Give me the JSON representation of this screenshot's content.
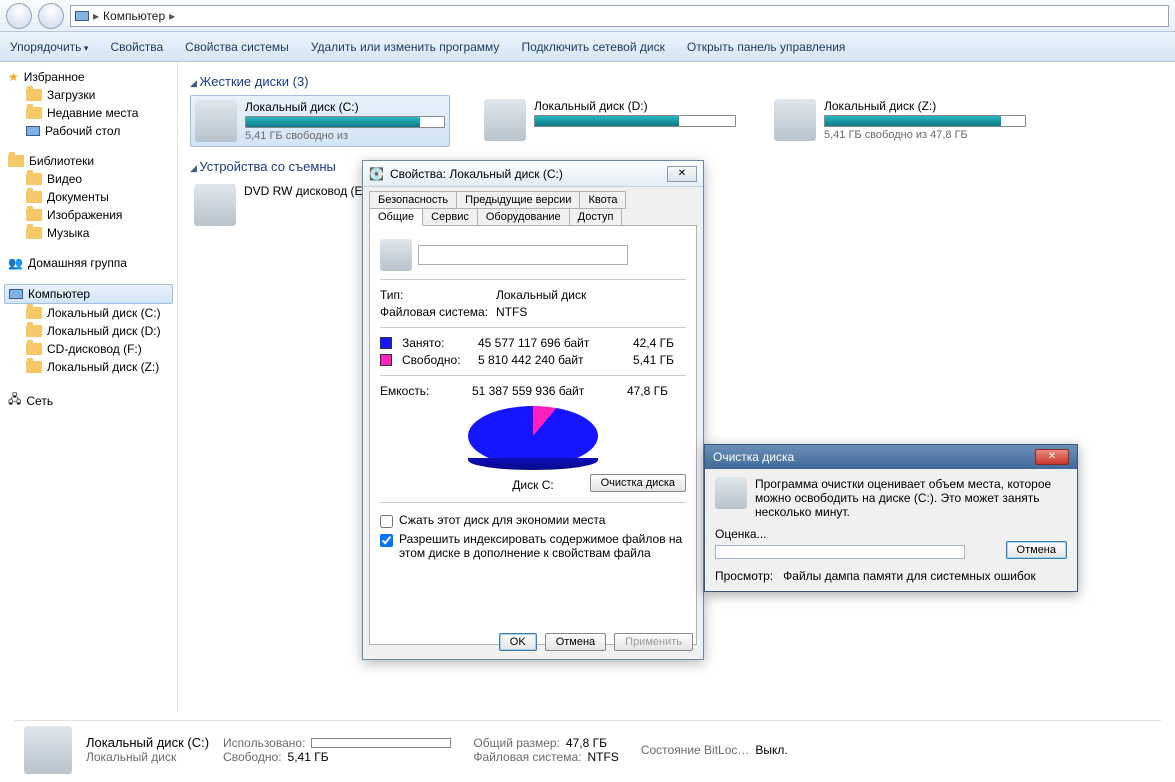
{
  "breadcrumb": {
    "root": "Компьютер"
  },
  "toolbar": {
    "organize": "Упорядочить",
    "properties": "Свойства",
    "sysprops": "Свойства системы",
    "uninstall": "Удалить или изменить программу",
    "mapdrive": "Подключить сетевой диск",
    "controlpanel": "Открыть панель управления"
  },
  "sidebar": {
    "favorites": "Избранное",
    "downloads": "Загрузки",
    "recent": "Недавние места",
    "desktop": "Рабочий стол",
    "libraries": "Библиотеки",
    "videos": "Видео",
    "documents": "Документы",
    "pictures": "Изображения",
    "music": "Музыка",
    "homegroup": "Домашняя группа",
    "computer": "Компьютер",
    "driveC": "Локальный диск (C:)",
    "driveD": "Локальный диск (D:)",
    "driveF": "CD-дисковод (F:)",
    "driveZ": "Локальный диск (Z:)",
    "network": "Сеть"
  },
  "sections": {
    "hdd": "Жесткие диски (3)",
    "removable": "Устройства со съемны"
  },
  "drives": {
    "c": {
      "name": "Локальный диск (C:)",
      "free": "5,41 ГБ свободно из"
    },
    "d": {
      "name": "Локальный диск (D:)"
    },
    "z": {
      "name": "Локальный диск (Z:)",
      "free": "5,41 ГБ свободно из 47,8 ГБ"
    },
    "dvd": {
      "name": "DVD RW дисковод (E"
    }
  },
  "props": {
    "title": "Свойства: Локальный диск (C:)",
    "tabs": {
      "security": "Безопасность",
      "prev": "Предыдущие версии",
      "quota": "Квота",
      "general": "Общие",
      "service": "Сервис",
      "hardware": "Оборудование",
      "access": "Доступ"
    },
    "typeLabel": "Тип:",
    "typeVal": "Локальный диск",
    "fsLabel": "Файловая система:",
    "fsVal": "NTFS",
    "usedLabel": "Занято:",
    "usedBytes": "45 577 117 696 байт",
    "usedGB": "42,4 ГБ",
    "freeLabel": "Свободно:",
    "freeBytes": "5 810 442 240 байт",
    "freeGB": "5,41 ГБ",
    "capLabel": "Емкость:",
    "capBytes": "51 387 559 936 байт",
    "capGB": "47,8 ГБ",
    "diskLabel": "Диск C:",
    "cleanup": "Очистка диска",
    "compress": "Сжать этот диск для экономии места",
    "index": "Разрешить индексировать содержимое файлов на этом диске в дополнение к свойствам файла",
    "ok": "OK",
    "cancel": "Отмена",
    "apply": "Применить"
  },
  "cleanup": {
    "title": "Очистка диска",
    "msg": "Программа очистки оценивает объем места, которое можно освободить на диске  (C:). Это может занять несколько минут.",
    "evaluating": "Оценка...",
    "cancel": "Отмена",
    "scanLabel": "Просмотр:",
    "scanVal": "Файлы дампа памяти для системных ошибок"
  },
  "details": {
    "name": "Локальный диск (C:)",
    "type": "Локальный диск",
    "usedK": "Использовано:",
    "totalK": "Общий размер:",
    "totalV": "47,8 ГБ",
    "bitlockK": "Состояние BitLoc…",
    "bitlockV": "Выкл.",
    "freeK": "Свободно:",
    "freeV": "5,41 ГБ",
    "fsK": "Файловая система:",
    "fsV": "NTFS"
  }
}
